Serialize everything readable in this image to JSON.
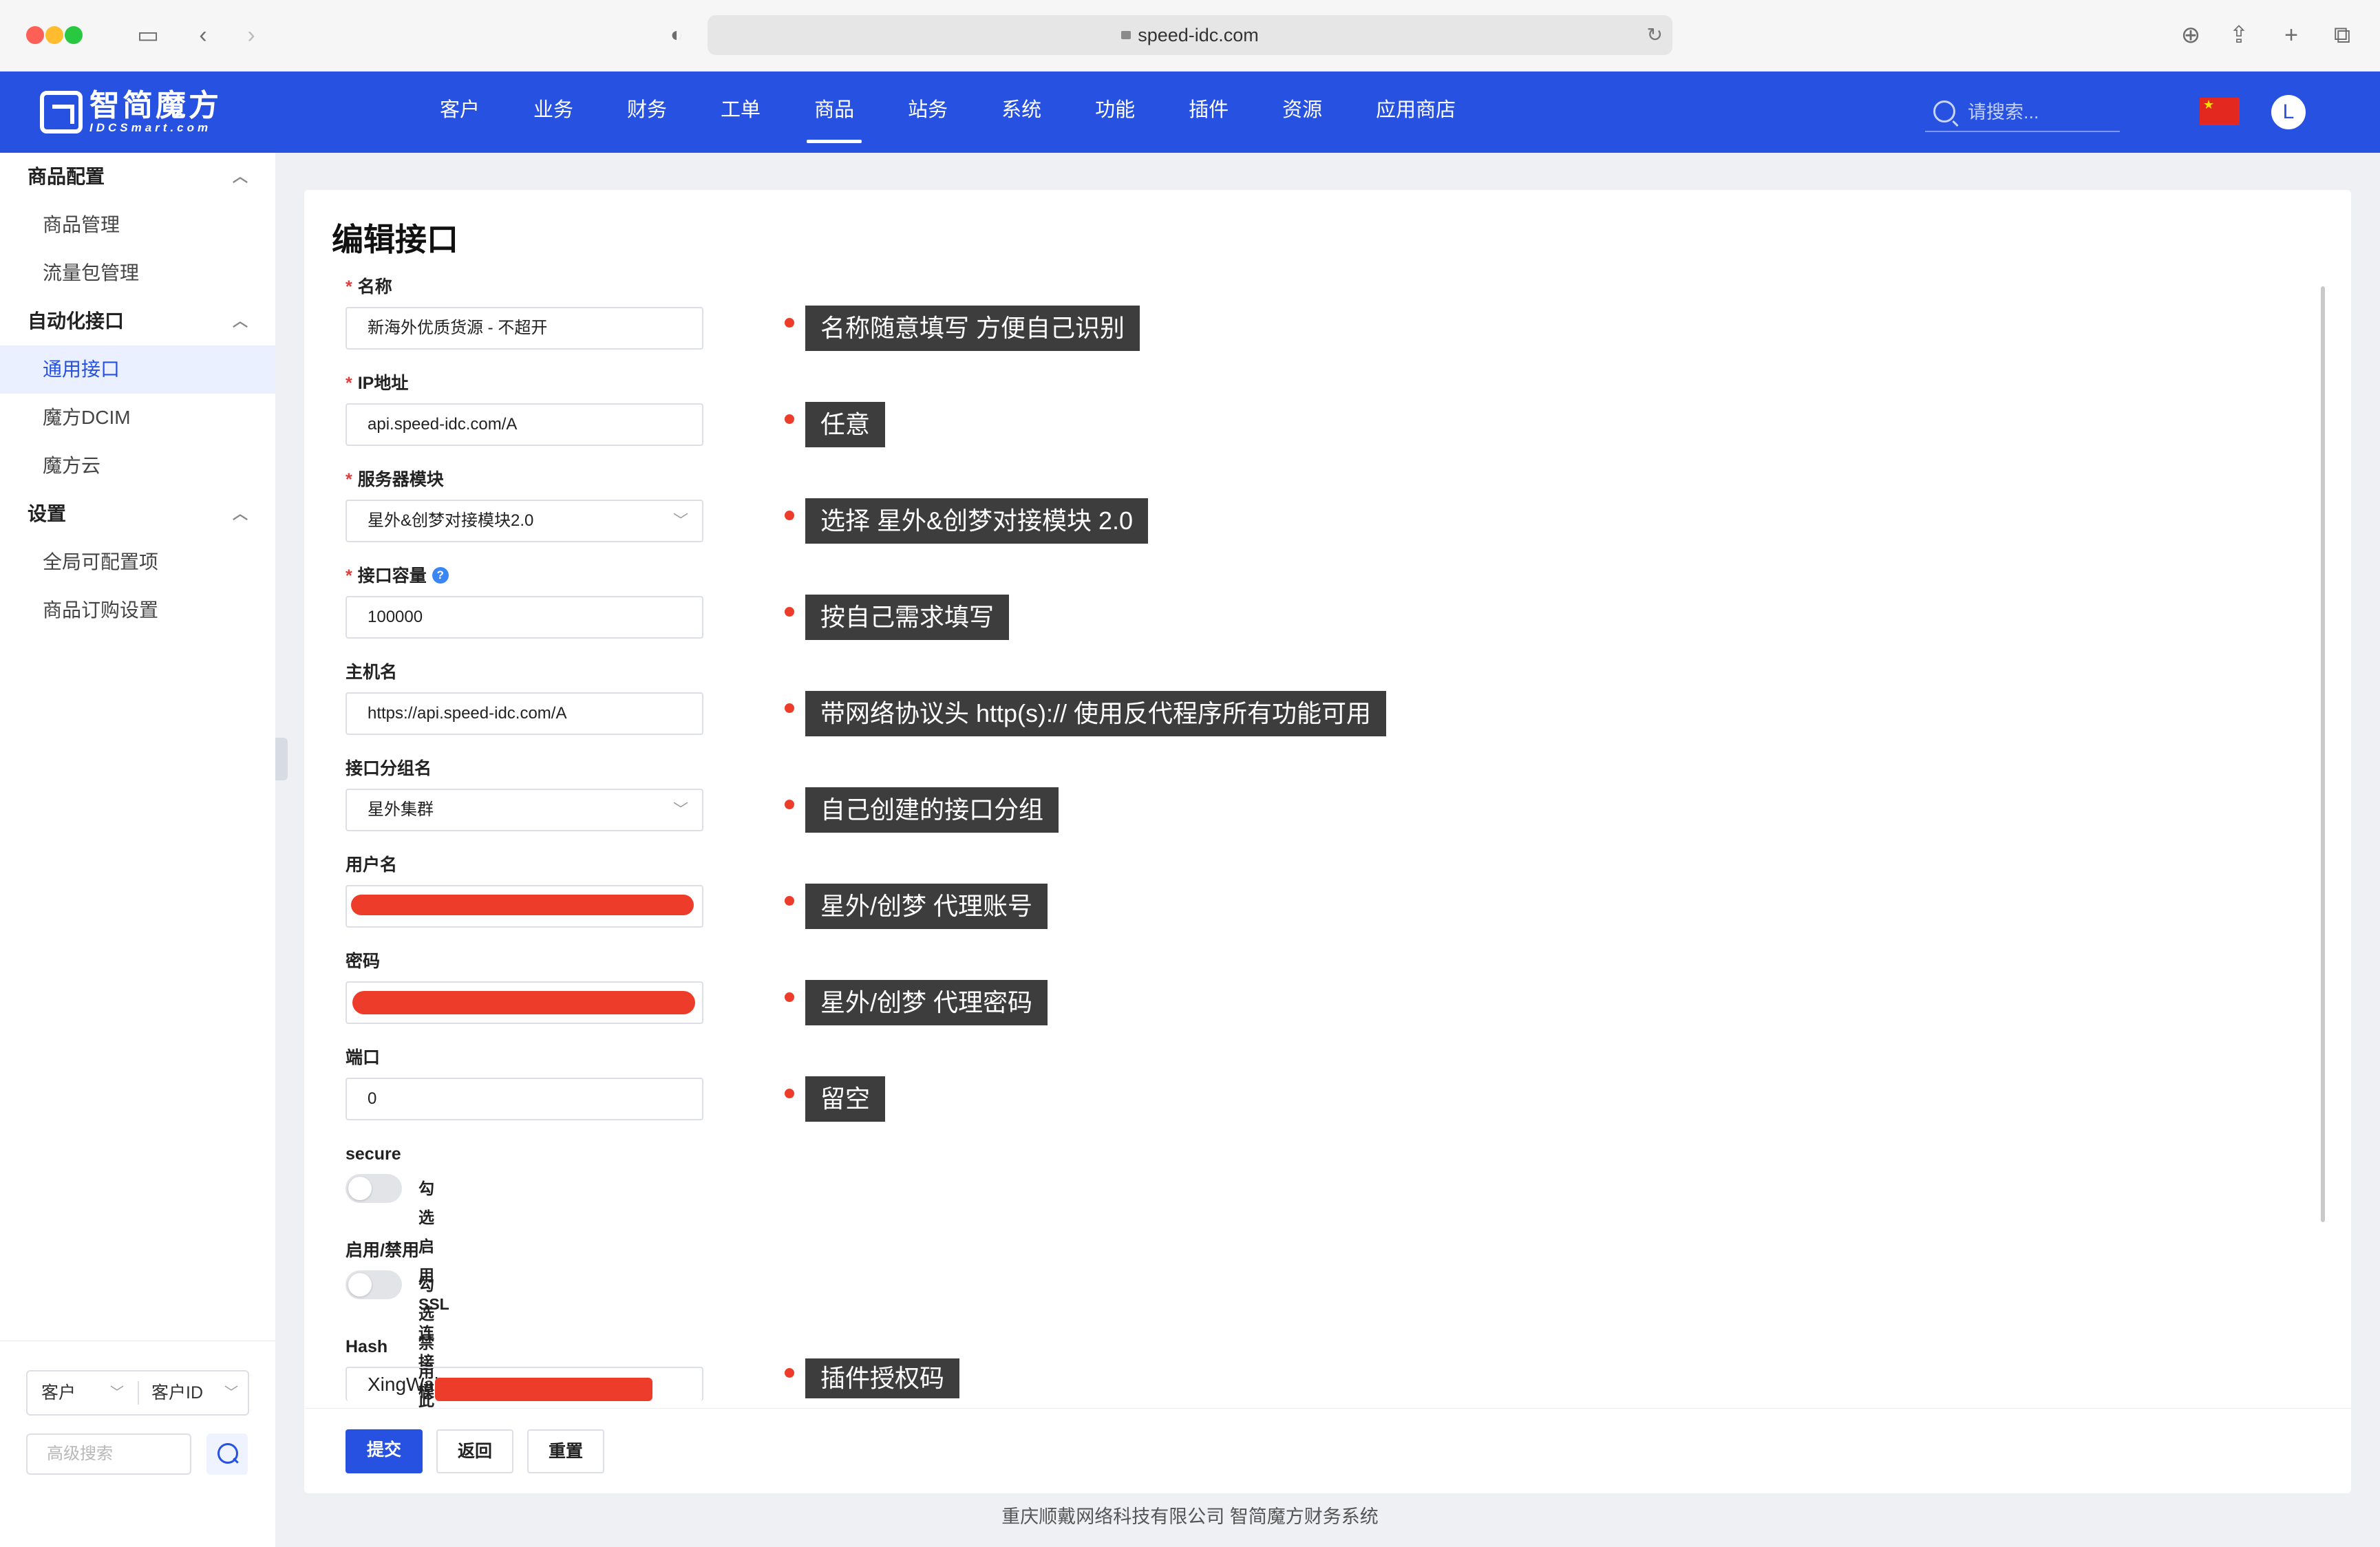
{
  "browser": {
    "url": "speed-idc.com"
  },
  "logo": {
    "name": "智简魔方",
    "sub": "IDCSmart.com"
  },
  "nav": {
    "items": [
      {
        "label": "客户"
      },
      {
        "label": "业务"
      },
      {
        "label": "财务"
      },
      {
        "label": "工单"
      },
      {
        "label": "商品",
        "active": true
      },
      {
        "label": "站务"
      },
      {
        "label": "系统"
      },
      {
        "label": "功能"
      },
      {
        "label": "插件"
      },
      {
        "label": "资源"
      },
      {
        "label": "应用商店"
      }
    ],
    "search_placeholder": "请搜索...",
    "avatar_letter": "L"
  },
  "sidebar": {
    "groups": [
      {
        "title": "商品配置",
        "items": [
          "商品管理",
          "流量包管理"
        ]
      },
      {
        "title": "自动化接口",
        "items": [
          "通用接口",
          "魔方DCIM",
          "魔方云"
        ],
        "active": "通用接口"
      },
      {
        "title": "设置",
        "items": [
          "全局可配置项",
          "商品订购设置"
        ]
      }
    ],
    "filter": {
      "left": "客户",
      "right": "客户ID",
      "adv_placeholder": "高级搜索"
    }
  },
  "page": {
    "title": "编辑接口"
  },
  "form": {
    "name": {
      "label": "名称",
      "value": "新海外优质货源 - 不超开",
      "note": "名称随意填写 方便自己识别"
    },
    "ip": {
      "label": "IP地址",
      "value": "api.speed-idc.com/A",
      "note": "任意"
    },
    "module": {
      "label": "服务器模块",
      "value": "星外&创梦对接模块2.0",
      "note": "选择 星外&创梦对接模块 2.0"
    },
    "capacity": {
      "label": "接口容量",
      "value": "100000",
      "note": "按自己需求填写"
    },
    "hostname": {
      "label": "主机名",
      "value": "https://api.speed-idc.com/A",
      "note": "带网络协议头 http(s):// 使用反代程序所有功能可用"
    },
    "group": {
      "label": "接口分组名",
      "value": "星外集群",
      "note": "自己创建的接口分组"
    },
    "username": {
      "label": "用户名",
      "note": "星外/创梦 代理账号"
    },
    "password": {
      "label": "密码",
      "note": "星外/创梦 代理密码"
    },
    "port": {
      "label": "端口",
      "value": "0",
      "note": "留空"
    },
    "secure": {
      "label": "secure",
      "toggle_label": "勾选启用SSL连接模式",
      "on": false
    },
    "enable": {
      "label": "启用/禁用",
      "toggle_label": "勾选禁用此接口",
      "on": false
    },
    "hash": {
      "label": "Hash",
      "value": "XingWai",
      "note": "插件授权码"
    }
  },
  "buttons": {
    "submit": "提交",
    "back": "返回",
    "reset": "重置"
  },
  "footer": {
    "copyright": "重庆顺戴网络科技有限公司 智简魔方财务系统"
  },
  "colors": {
    "brand": "#2651e1",
    "annotation_dot": "#ee3c2a",
    "annotation_bg": "#3d3d3d"
  }
}
